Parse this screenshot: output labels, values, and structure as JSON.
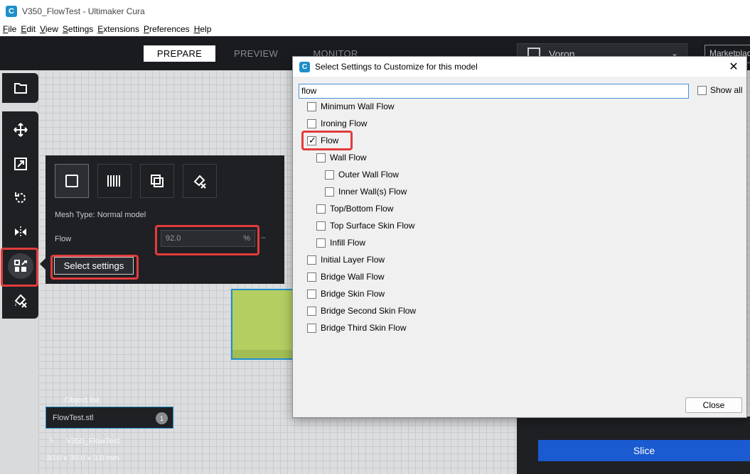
{
  "window": {
    "title": "V350_FlowTest - Ultimaker Cura",
    "logo_letter": "C"
  },
  "menu": [
    {
      "first": "F",
      "rest": "ile"
    },
    {
      "first": "E",
      "rest": "dit"
    },
    {
      "first": "V",
      "rest": "iew"
    },
    {
      "first": "S",
      "rest": "ettings"
    },
    {
      "first": "E",
      "rest": "xtensions"
    },
    {
      "first": "P",
      "rest": "references"
    },
    {
      "first": "H",
      "rest": "elp"
    }
  ],
  "stages": {
    "prepare": "PREPARE",
    "preview": "PREVIEW",
    "monitor": "MONITOR"
  },
  "printer": {
    "name": "Voron"
  },
  "marketplace": "Marketplace",
  "per_model": {
    "mesh_type": "Mesh Type: Normal model",
    "flow_label": "Flow",
    "flow_value": "92.0",
    "flow_unit": "%",
    "dash": "–",
    "select_settings": "Select settings"
  },
  "object_list": {
    "title": "Object list",
    "item": "FlowTest.stl",
    "badge": "1",
    "project": "V350_FlowTest",
    "dimensions": "30.0 x 30.0 x 3.0 mm"
  },
  "slice": "Slice",
  "dialog": {
    "title": "Select Settings to Customize for this model",
    "search_value": "flow",
    "show_all": "Show all",
    "close": "Close",
    "settings": [
      {
        "label": "Minimum Wall Flow",
        "checked": false
      },
      {
        "label": "Ironing Flow",
        "checked": false
      },
      {
        "label": "Flow",
        "checked": true
      },
      {
        "label": "Wall Flow",
        "checked": false
      },
      {
        "label": "Outer Wall Flow",
        "checked": false
      },
      {
        "label": "Inner Wall(s) Flow",
        "checked": false
      },
      {
        "label": "Top/Bottom Flow",
        "checked": false
      },
      {
        "label": "Top Surface Skin Flow",
        "checked": false
      },
      {
        "label": "Infill Flow",
        "checked": false
      },
      {
        "label": "Initial Layer Flow",
        "checked": false
      },
      {
        "label": "Bridge Wall Flow",
        "checked": false
      },
      {
        "label": "Bridge Skin Flow",
        "checked": false
      },
      {
        "label": "Bridge Second Skin Flow",
        "checked": false
      },
      {
        "label": "Bridge Third Skin Flow",
        "checked": false
      }
    ]
  }
}
